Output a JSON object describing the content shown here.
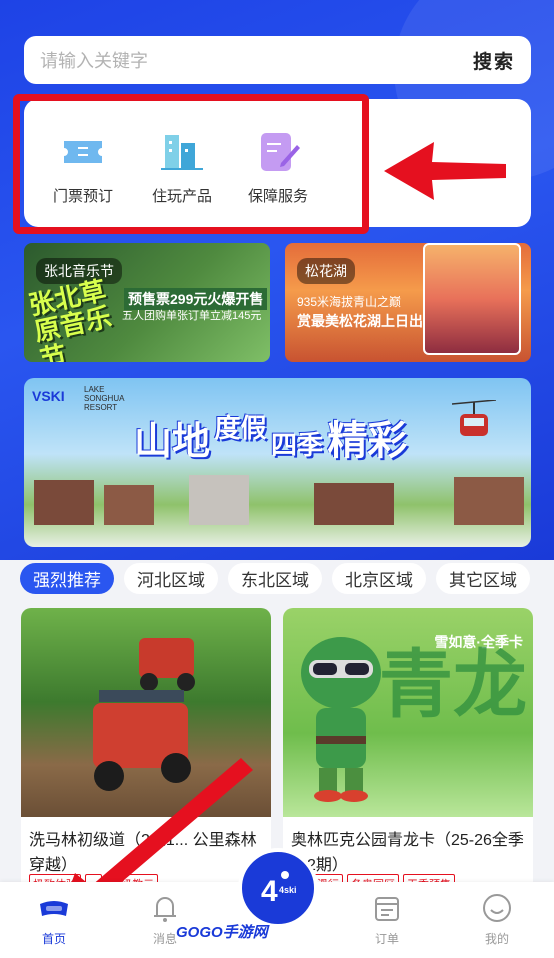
{
  "search": {
    "placeholder": "请输入关键字",
    "button": "搜索"
  },
  "services": [
    {
      "label": "门票预订",
      "icon": "ticket-icon"
    },
    {
      "label": "住玩产品",
      "icon": "building-icon"
    },
    {
      "label": "保障服务",
      "icon": "document-pen-icon"
    }
  ],
  "banners": {
    "left": {
      "tag": "张北音乐节",
      "big": "张北草原音乐节",
      "line1": "预售票299元火爆开售",
      "line2": "五人团购单张订单立减145元"
    },
    "right": {
      "tag": "松花湖",
      "sub1": "935米海拔青山之巅",
      "sub2": "赏最美松花湖上日出"
    },
    "main": {
      "logo": "VSKI",
      "logo_sub": "LAKE SONGHUA RESORT",
      "headline": [
        "山地",
        "度假",
        "四季",
        "精彩"
      ]
    }
  },
  "tabs": [
    "强烈推荐",
    "河北区域",
    "东北区域",
    "北京区域",
    "其它区域"
  ],
  "products": [
    {
      "title": "洗马林初级道（2人1... 公里森林穿越）",
      "badges": [
        "极致体验",
        "...",
        "中级教元"
      ]
    },
    {
      "title": "奥林匹克公园青龙卡（25-26全季卡2期）",
      "corner": "雪如意·全季卡",
      "big": "青龙",
      "badges": [
        "畅享滑行",
        "冬奥园区",
        "无季预售"
      ]
    }
  ],
  "tabbar": [
    {
      "label": "首页",
      "icon": "goggles-icon"
    },
    {
      "label": "消息",
      "icon": "bell-icon"
    },
    {
      "label": "订单",
      "icon": "calendar-icon"
    },
    {
      "label": "我的",
      "icon": "profile-icon"
    }
  ],
  "center_button": {
    "label": "4ski"
  },
  "watermark": "GOGO手游网",
  "colors": {
    "primary": "#1a3ad8",
    "accent_red": "#e5101f"
  }
}
